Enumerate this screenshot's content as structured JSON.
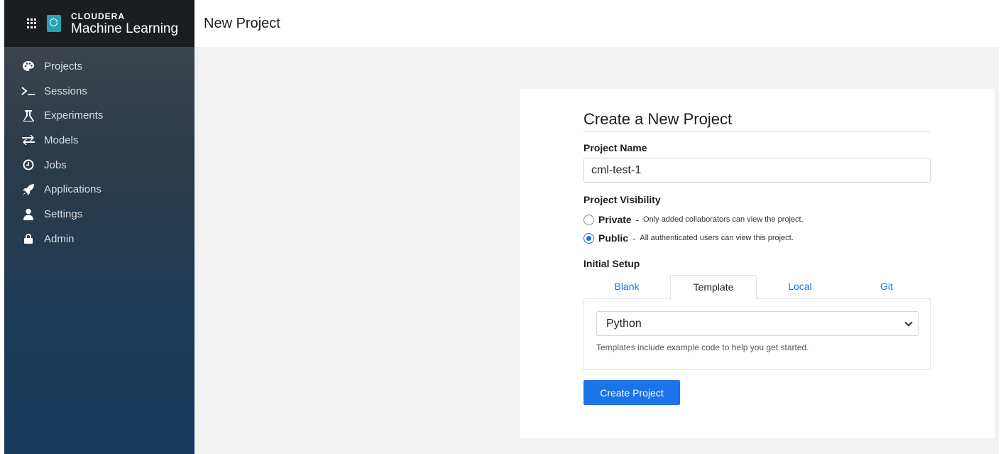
{
  "brand": {
    "company": "CLOUDERA",
    "product": "Machine Learning"
  },
  "sidebar": {
    "items": [
      {
        "label": "Projects",
        "icon": "palette-icon"
      },
      {
        "label": "Sessions",
        "icon": "terminal-icon"
      },
      {
        "label": "Experiments",
        "icon": "flask-icon"
      },
      {
        "label": "Models",
        "icon": "exchange-icon"
      },
      {
        "label": "Jobs",
        "icon": "clock-icon"
      },
      {
        "label": "Applications",
        "icon": "rocket-icon"
      },
      {
        "label": "Settings",
        "icon": "user-icon"
      },
      {
        "label": "Admin",
        "icon": "lock-icon"
      }
    ]
  },
  "header": {
    "title": "New Project"
  },
  "form": {
    "title": "Create a New Project",
    "name_label": "Project Name",
    "name_value": "cml-test-1",
    "visibility_label": "Project Visibility",
    "visibility_options": [
      {
        "title": "Private",
        "sep": "-",
        "desc": "Only added collaborators can view the project.",
        "checked": false
      },
      {
        "title": "Public",
        "sep": "-",
        "desc": "All authenticated users can view this project.",
        "checked": true
      }
    ],
    "setup_label": "Initial Setup",
    "tabs": [
      "Blank",
      "Template",
      "Local",
      "Git"
    ],
    "active_tab": "Template",
    "template_value": "Python",
    "template_help": "Templates include example code to help you get started.",
    "submit_label": "Create Project"
  },
  "colors": {
    "accent": "#1a73e8",
    "sidebar_top": "#43484e",
    "sidebar_bottom": "#17395a",
    "brand_bar": "#1b1e21",
    "logo": "#27a3b3"
  }
}
